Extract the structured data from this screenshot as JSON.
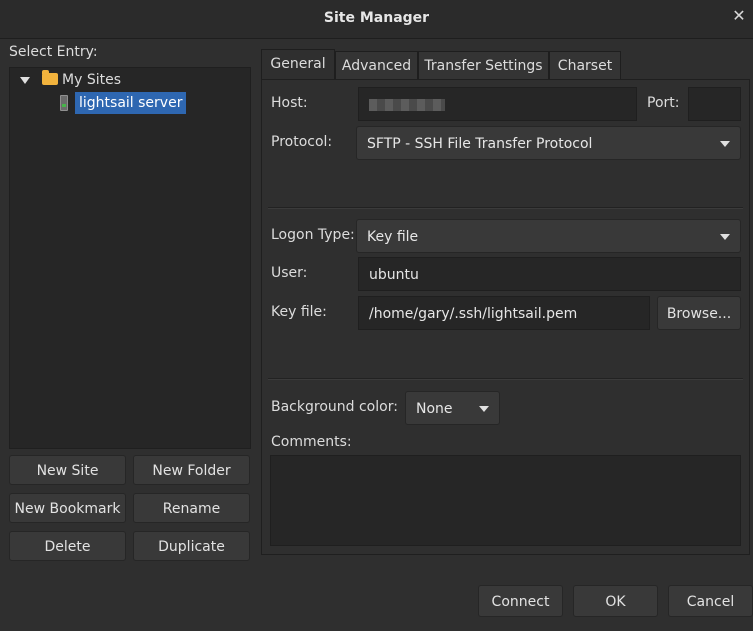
{
  "window": {
    "title": "Site Manager",
    "close_glyph": "✕"
  },
  "left": {
    "select_entry_label": "Select Entry:",
    "tree": {
      "folder_label": "My Sites",
      "site_label": "lightsail server"
    },
    "buttons": {
      "new_site": "New Site",
      "new_folder": "New Folder",
      "new_bookmark": "New Bookmark",
      "rename": "Rename",
      "delete": "Delete",
      "duplicate": "Duplicate"
    }
  },
  "tabs": [
    "General",
    "Advanced",
    "Transfer Settings",
    "Charset"
  ],
  "general": {
    "host_label": "Host:",
    "host_value": "",
    "port_label": "Port:",
    "port_value": "",
    "protocol_label": "Protocol:",
    "protocol_value": "SFTP - SSH File Transfer Protocol",
    "logon_type_label": "Logon Type:",
    "logon_type_value": "Key file",
    "user_label": "User:",
    "user_value": "ubuntu",
    "key_file_label": "Key file:",
    "key_file_value": "/home/gary/.ssh/lightsail.pem",
    "browse_label": "Browse...",
    "bg_color_label": "Background color:",
    "bg_color_value": "None",
    "comments_label": "Comments:"
  },
  "footer": {
    "connect": "Connect",
    "ok": "OK",
    "cancel": "Cancel"
  },
  "colors": {
    "selection": "#2e67b1",
    "folder": "#f2b33d",
    "background": "#2f2f2f"
  }
}
